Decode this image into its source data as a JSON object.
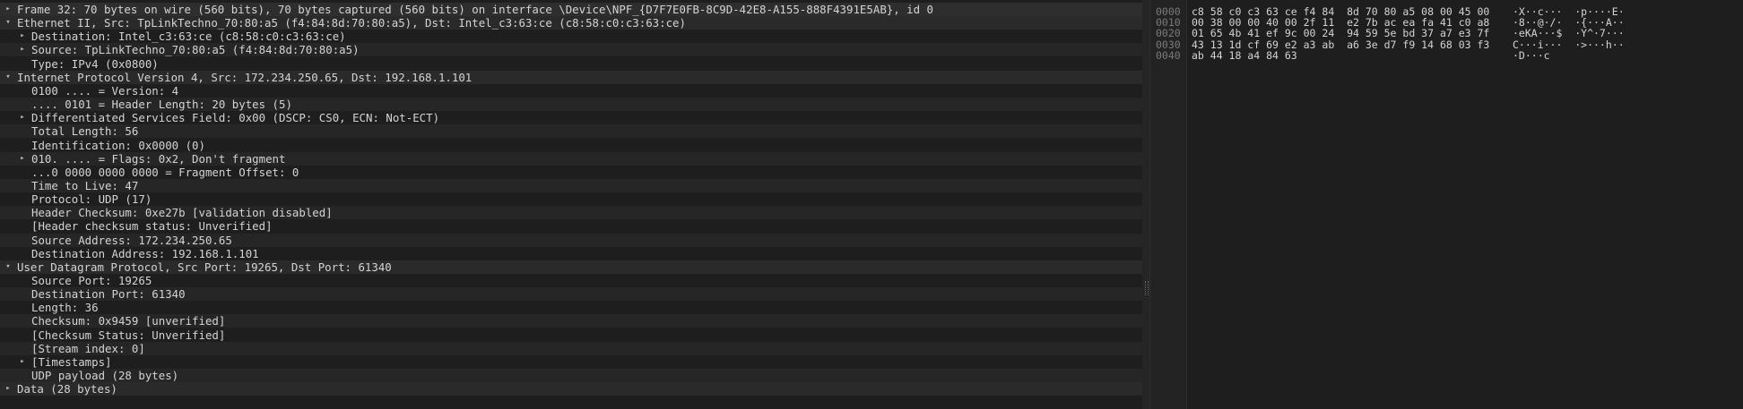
{
  "details": {
    "rows": [
      {
        "text": "Frame 32: 70 bytes on wire (560 bits), 70 bytes captured (560 bits) on interface \\Device\\NPF_{D7F7E0FB-8C9D-42E8-A155-888F4391E5AB}, id 0",
        "arrow": "collapsed"
      },
      {
        "text": "Ethernet II, Src: TpLinkTechno_70:80:a5 (f4:84:8d:70:80:a5), Dst: Intel_c3:63:ce (c8:58:c0:c3:63:ce)",
        "arrow": "expanded"
      },
      {
        "text": "Destination: Intel_c3:63:ce (c8:58:c0:c3:63:ce)",
        "arrow": "collapsed"
      },
      {
        "text": "Source: TpLinkTechno_70:80:a5 (f4:84:8d:70:80:a5)",
        "arrow": "collapsed"
      },
      {
        "text": "Type: IPv4 (0x0800)",
        "arrow": "none"
      },
      {
        "text": "Internet Protocol Version 4, Src: 172.234.250.65, Dst: 192.168.1.101",
        "arrow": "expanded"
      },
      {
        "text": "0100 .... = Version: 4",
        "arrow": "none"
      },
      {
        "text": ".... 0101 = Header Length: 20 bytes (5)",
        "arrow": "none"
      },
      {
        "text": "Differentiated Services Field: 0x00 (DSCP: CS0, ECN: Not-ECT)",
        "arrow": "collapsed"
      },
      {
        "text": "Total Length: 56",
        "arrow": "none"
      },
      {
        "text": "Identification: 0x0000 (0)",
        "arrow": "none"
      },
      {
        "text": "010. .... = Flags: 0x2, Don't fragment",
        "arrow": "collapsed"
      },
      {
        "text": "...0 0000 0000 0000 = Fragment Offset: 0",
        "arrow": "none"
      },
      {
        "text": "Time to Live: 47",
        "arrow": "none"
      },
      {
        "text": "Protocol: UDP (17)",
        "arrow": "none"
      },
      {
        "text": "Header Checksum: 0xe27b [validation disabled]",
        "arrow": "none"
      },
      {
        "text": "[Header checksum status: Unverified]",
        "arrow": "none"
      },
      {
        "text": "Source Address: 172.234.250.65",
        "arrow": "none"
      },
      {
        "text": "Destination Address: 192.168.1.101",
        "arrow": "none"
      },
      {
        "text": "User Datagram Protocol, Src Port: 19265, Dst Port: 61340",
        "arrow": "expanded"
      },
      {
        "text": "Source Port: 19265",
        "arrow": "none"
      },
      {
        "text": "Destination Port: 61340",
        "arrow": "none"
      },
      {
        "text": "Length: 36",
        "arrow": "none"
      },
      {
        "text": "Checksum: 0x9459 [unverified]",
        "arrow": "none"
      },
      {
        "text": "[Checksum Status: Unverified]",
        "arrow": "none"
      },
      {
        "text": "[Stream index: 0]",
        "arrow": "none"
      },
      {
        "text": "[Timestamps]",
        "arrow": "collapsed"
      },
      {
        "text": "UDP payload (28 bytes)",
        "arrow": "none"
      },
      {
        "text": "Data (28 bytes)",
        "arrow": "collapsed"
      }
    ]
  },
  "bytes": {
    "rows": [
      {
        "offset": "0000",
        "hex": "c8 58 c0 c3 63 ce f4 84  8d 70 80 a5 08 00 45 00",
        "ascii": "·X··c···  ·p····E·"
      },
      {
        "offset": "0010",
        "hex": "00 38 00 00 40 00 2f 11  e2 7b ac ea fa 41 c0 a8",
        "ascii": "·8··@·/·  ·{···A··"
      },
      {
        "offset": "0020",
        "hex": "01 65 4b 41 ef 9c 00 24  94 59 5e bd 37 a7 e3 7f",
        "ascii": "·eKA···$  ·Y^·7···"
      },
      {
        "offset": "0030",
        "hex": "43 13 1d cf 69 e2 a3 ab  a6 3e d7 f9 14 68 03 f3",
        "ascii": "C···i···  ·>···h··"
      },
      {
        "offset": "0040",
        "hex": "ab 44 18 a4 84 63",
        "ascii": "·D···c"
      }
    ]
  }
}
